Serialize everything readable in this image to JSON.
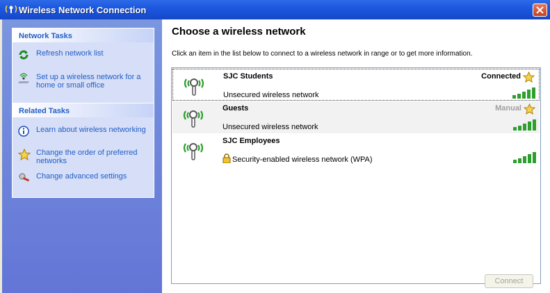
{
  "window": {
    "title": "Wireless Network Connection",
    "title_icon": "wireless-antenna-icon"
  },
  "sidebar": {
    "network_tasks": {
      "header": "Network Tasks",
      "items": [
        {
          "label": "Refresh network list",
          "icon": "refresh-icon"
        },
        {
          "label": "Set up a wireless network for a home or small office",
          "icon": "setup-wizard-icon"
        }
      ]
    },
    "related_tasks": {
      "header": "Related Tasks",
      "items": [
        {
          "label": "Learn about wireless networking",
          "icon": "info-icon"
        },
        {
          "label": "Change the order of preferred networks",
          "icon": "star-icon"
        },
        {
          "label": "Change advanced settings",
          "icon": "settings-icon"
        }
      ]
    }
  },
  "main": {
    "heading": "Choose a wireless network",
    "intro": "Click an item in the list below to connect to a wireless network in range or to get more information.",
    "networks": [
      {
        "name": "SJC Students",
        "status": "Connected",
        "description": "Unsecured wireless network",
        "signal_bars": 5,
        "preferred": true,
        "secured": false
      },
      {
        "name": "Guests",
        "status": "Manual",
        "description": "Unsecured wireless network",
        "signal_bars": 5,
        "preferred": true,
        "secured": false
      },
      {
        "name": "SJC Employees",
        "status": "",
        "description": "Security-enabled wireless network (WPA)",
        "signal_bars": 5,
        "preferred": false,
        "secured": true
      }
    ],
    "connect_label": "Connect"
  },
  "colors": {
    "titlebar": "#1F5AE0",
    "sidebar": "#6F86DB",
    "link": "#215DC6",
    "signal": "#2E9E2E"
  }
}
